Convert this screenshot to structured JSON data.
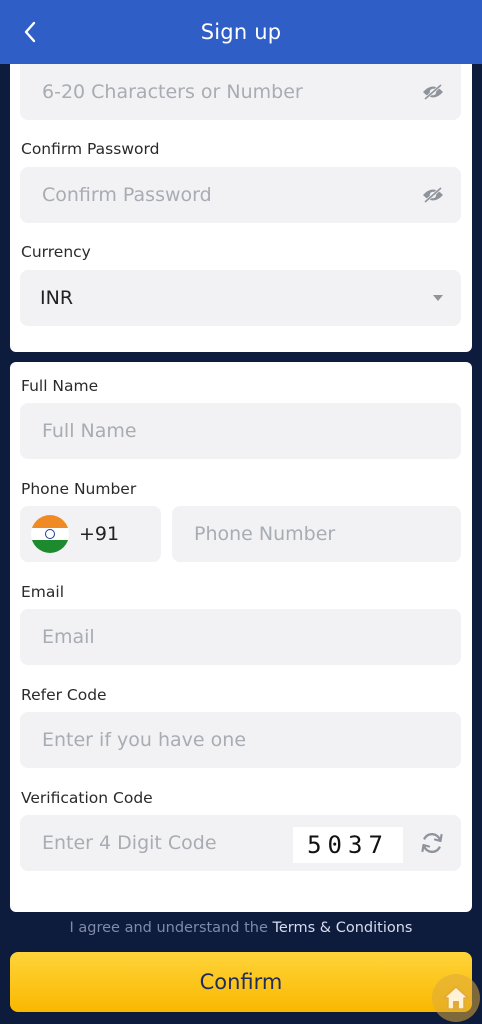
{
  "header": {
    "title": "Sign up"
  },
  "password": {
    "placeholder": "6-20 Characters or Number"
  },
  "confirm_password": {
    "label": "Confirm Password",
    "placeholder": "Confirm Password"
  },
  "currency": {
    "label": "Currency",
    "value": "INR"
  },
  "full_name": {
    "label": "Full Name",
    "placeholder": "Full Name"
  },
  "phone": {
    "label": "Phone Number",
    "code": "+91",
    "placeholder": "Phone Number"
  },
  "email": {
    "label": "Email",
    "placeholder": "Email"
  },
  "refer": {
    "label": "Refer Code",
    "placeholder": "Enter if you have one"
  },
  "verification": {
    "label": "Verification Code",
    "placeholder": "Enter 4 Digit Code",
    "captcha": "5037"
  },
  "terms": {
    "prefix": "I agree and understand the ",
    "link": "Terms & Conditions"
  },
  "confirm_button": {
    "label": "Confirm"
  },
  "colors": {
    "header": "#2f5ec7",
    "background": "#0d1b3d",
    "button": "#f9b800"
  },
  "icons": {
    "back": "chevron-left-icon",
    "eye": "eye-off-icon",
    "dropdown": "caret-down-icon",
    "refresh": "refresh-icon",
    "home": "home-icon"
  }
}
